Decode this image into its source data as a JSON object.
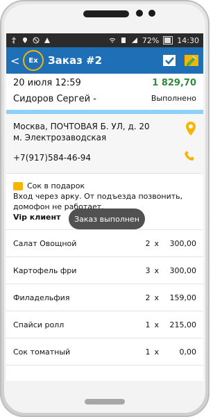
{
  "status_bar": {
    "time": "14:30",
    "battery": "72%"
  },
  "header": {
    "back": "<",
    "logo_text": "Ex",
    "title": "Заказ #2"
  },
  "order": {
    "datetime": "20 июля 12:59",
    "amount": "1 829,70",
    "customer": "Сидоров Сергей -",
    "status": "Выполнено"
  },
  "address": {
    "line1": "Москва, ПОЧТОВАЯ Б. УЛ, д. 20",
    "line2": "м. Электрозаводская",
    "phone": "+7(917)584-46-94"
  },
  "notes": {
    "gift": "Сок в подарок",
    "line1": "Вход через арку. От подъезда позвонить,",
    "line2": "домофон не работает.",
    "vip": "Vip клиент"
  },
  "toast": "Заказ выполнен",
  "items": [
    {
      "name": "Салат Овощной",
      "qty": "2",
      "x": "x",
      "price": "300,00"
    },
    {
      "name": "Картофель фри",
      "qty": "3",
      "x": "x",
      "price": "300,00"
    },
    {
      "name": "Филадельфия",
      "qty": "2",
      "x": "x",
      "price": "159,00"
    },
    {
      "name": "Спайси ролл",
      "qty": "1",
      "x": "x",
      "price": "215,00"
    },
    {
      "name": "Сок томатный",
      "qty": "1",
      "x": "x",
      "price": "0,00"
    }
  ],
  "colors": {
    "appbar": "#1f6fb7",
    "accent": "#f7b500",
    "amount_green": "#2f8a3b",
    "strip_blue": "#8fd0f6"
  },
  "icons": {
    "back": "chevron-left-icon",
    "logo": "logo-icon",
    "done": "checkbox-icon",
    "edit": "edit-icon",
    "location": "location-icon",
    "phone": "phone-icon",
    "gift": "gift-note-icon"
  }
}
